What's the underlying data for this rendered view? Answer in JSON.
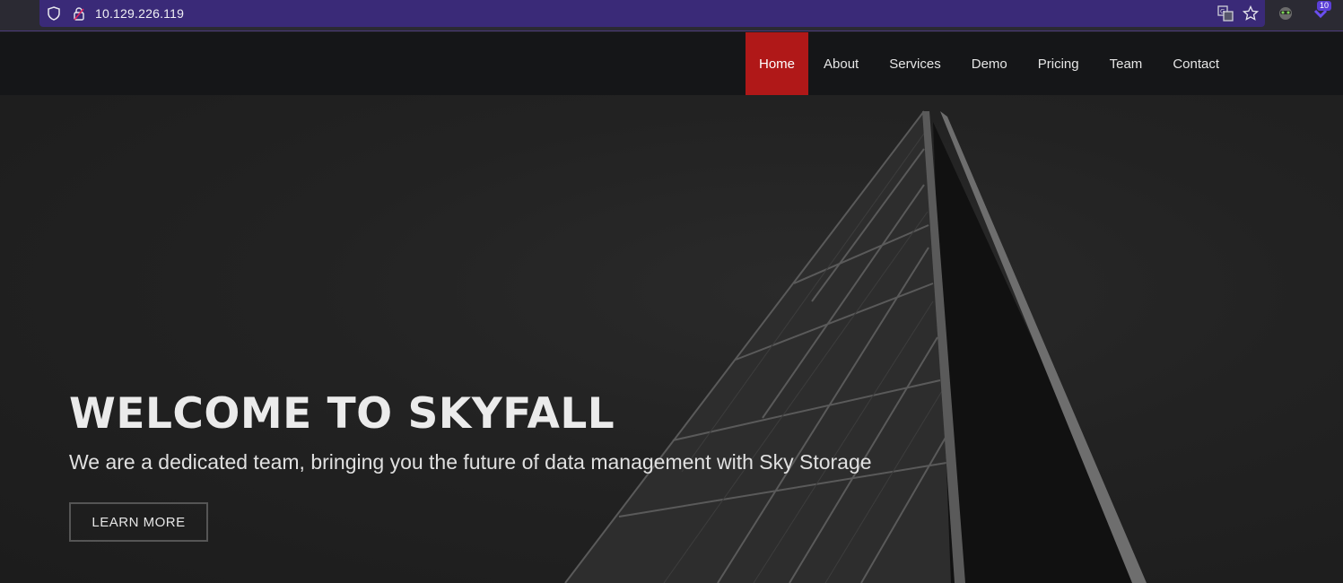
{
  "browser": {
    "url": "10.129.226.119",
    "extension_badge": "10",
    "accent_color": "#3a2a78"
  },
  "nav": {
    "items": [
      {
        "label": "Home",
        "active": true
      },
      {
        "label": "About"
      },
      {
        "label": "Services"
      },
      {
        "label": "Demo"
      },
      {
        "label": "Pricing"
      },
      {
        "label": "Team"
      },
      {
        "label": "Contact"
      }
    ],
    "active_color": "#b01818"
  },
  "hero": {
    "title": "WELCOME TO SKYFALL",
    "subtitle": "We are a dedicated team, bringing you the future of data management with Sky Storage",
    "cta_label": "LEARN MORE"
  },
  "icons": [
    "shield-icon",
    "lock-icon",
    "translate-icon",
    "star-icon",
    "extension-icon",
    "extension-badge-icon"
  ]
}
